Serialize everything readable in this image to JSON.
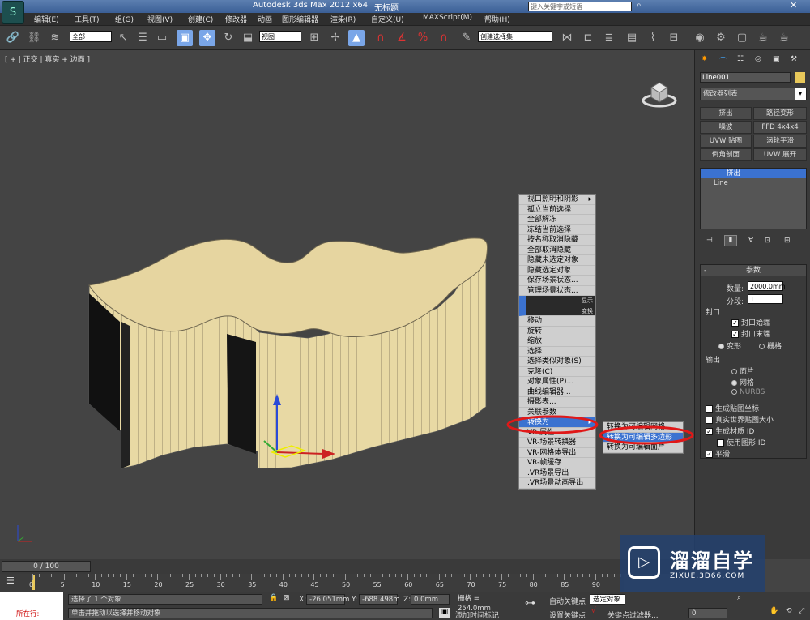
{
  "titlebar": {
    "app_title": "Autodesk 3ds Max  2012 x64",
    "doc_title": "无标题",
    "search_placeholder": "键入关键字或短语"
  },
  "menu": [
    "编辑(E)",
    "工具(T)",
    "组(G)",
    "视图(V)",
    "创建(C)",
    "修改器",
    "动画",
    "图形编辑器",
    "渲染(R)",
    "自定义(U)",
    "MAXScript(M)",
    "帮助(H)"
  ],
  "toolbar": {
    "selection_filter": "全部",
    "ref_coord": "视图",
    "named_selection": "创建选择集"
  },
  "viewport": {
    "label": "[ + | 正交 | 真实 + 边面 ]"
  },
  "quad_menu": {
    "items": [
      "视口照明和阴影",
      "孤立当前选择",
      "全部解冻",
      "冻结当前选择",
      "按名称取消隐藏",
      "全部取消隐藏",
      "隐藏未选定对象",
      "隐藏选定对象",
      "保存场景状态...",
      "管理场景状态..."
    ],
    "quadrant_labels": [
      "显示",
      "变换"
    ],
    "transform": [
      "移动",
      "旋转",
      "缩放",
      "选择",
      "选择类似对象(S)",
      "克隆(C)",
      "对象属性(P)...",
      "曲线编辑器...",
      "摄影表...",
      "关联参数",
      "转换为",
      "VR-属性",
      "VR-场景转换器",
      "VR-网格体导出",
      "VR-帧缓存",
      ".VR场景导出",
      ".VR场景动画导出"
    ],
    "submenu": [
      "转换为可编辑网格",
      "转换为可编辑多边形",
      "转换为可编辑面片"
    ]
  },
  "panel": {
    "object_name": "Line001",
    "modifier_list": "修改器列表",
    "modifier_buttons": [
      "挤出",
      "路径变形",
      "噪波",
      "FFD 4x4x4",
      "UVW 贴图",
      "涡轮平滑",
      "倒角剖面",
      "UVW 展开"
    ],
    "stack": [
      "挤出",
      "Line"
    ],
    "rollout_title": "参数",
    "amount_label": "数量:",
    "amount_value": "2000.0mm",
    "segments_label": "分段:",
    "segments_value": "1",
    "capping_group": "封口",
    "cap_start": "封口始端",
    "cap_end": "封口末端",
    "morph": "变形",
    "grid": "栅格",
    "output_group": "输出",
    "out_patch": "面片",
    "out_mesh": "网格",
    "out_nurbs": "NURBS",
    "gen_map": "生成贴图坐标",
    "real_world": "真实世界贴图大小",
    "gen_mat": "生成材质 ID",
    "use_shape": "使用图形 ID",
    "smooth": "平滑"
  },
  "timeline": {
    "frame": "0 / 100",
    "ticks": [
      "0",
      "5",
      "10",
      "15",
      "20",
      "25",
      "30",
      "35",
      "40",
      "45",
      "50",
      "55",
      "60",
      "65",
      "70",
      "75",
      "80",
      "85",
      "90"
    ]
  },
  "status": {
    "mode": "所在行:",
    "msg1": "选择了 1 个对象",
    "msg2": "单击并拖动以选择并移动对象",
    "x": "-26.051mm",
    "y": "-688.498m",
    "z": "0.0mm",
    "grid": "栅格 = 254.0mm",
    "auto_key": "自动关键点",
    "selected": "选定对象",
    "set_key": "设置关键点",
    "key_filters": "关键点过滤器...",
    "add_time_tag": "添加时间标记",
    "frame_value": "0"
  },
  "watermark": {
    "brand": "溜溜自学",
    "url": "ZIXUE.3D66.COM"
  }
}
